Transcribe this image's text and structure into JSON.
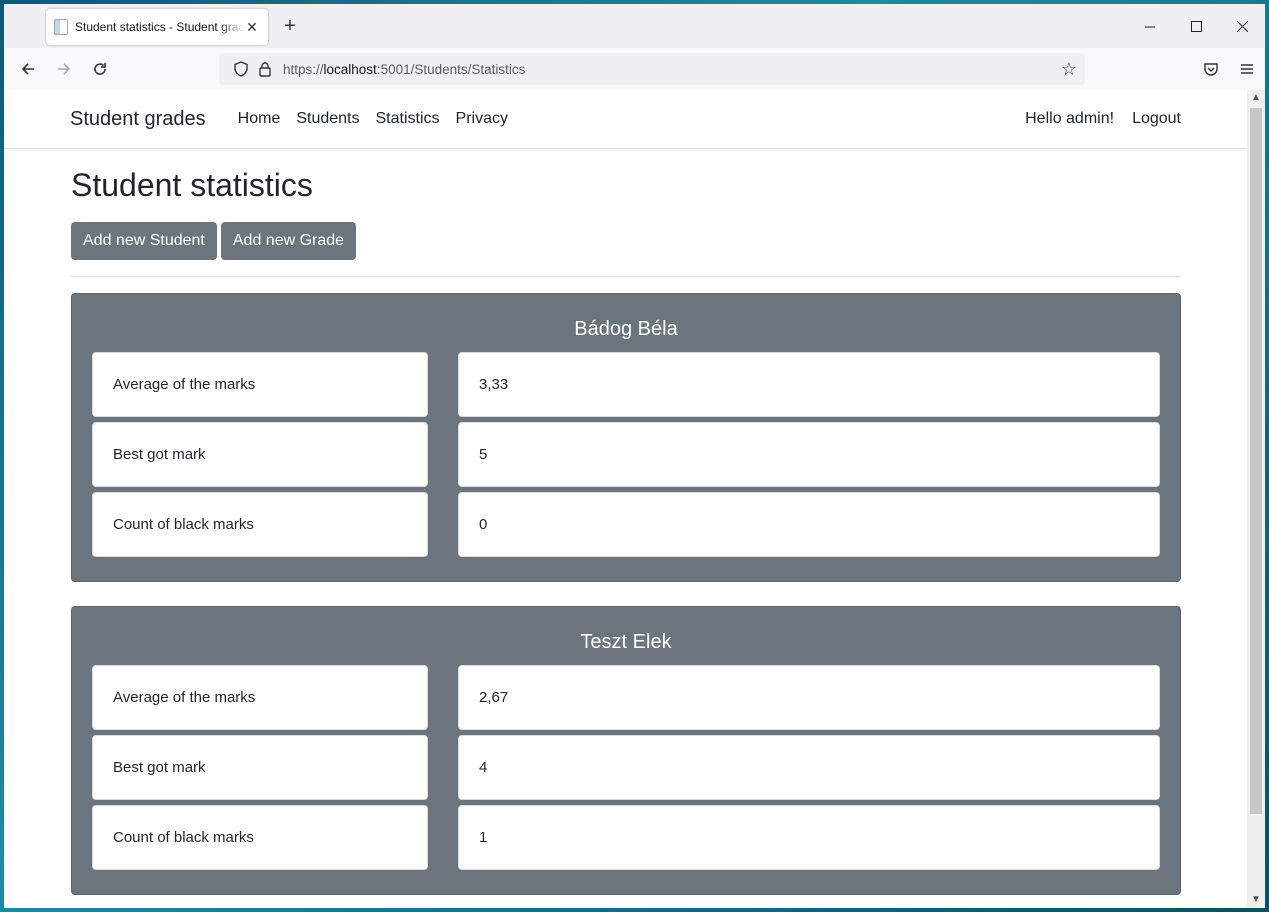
{
  "browser": {
    "tab_title": "Student statistics - Student grades",
    "url_prefix": "https://",
    "url_host": "localhost",
    "url_rest": ":5001/Students/Statistics"
  },
  "site": {
    "brand": "Student grades",
    "nav": [
      "Home",
      "Students",
      "Statistics",
      "Privacy"
    ],
    "greeting": "Hello admin!",
    "logout": "Logout"
  },
  "page": {
    "title": "Student statistics",
    "add_student": "Add new Student",
    "add_grade": "Add new Grade"
  },
  "students": [
    {
      "name": "Bádog Béla",
      "stats": [
        {
          "label": "Average of the marks",
          "value": "3,33"
        },
        {
          "label": "Best got mark",
          "value": "5"
        },
        {
          "label": "Count of black marks",
          "value": "0"
        }
      ]
    },
    {
      "name": "Teszt Elek",
      "stats": [
        {
          "label": "Average of the marks",
          "value": "2,67"
        },
        {
          "label": "Best got mark",
          "value": "4"
        },
        {
          "label": "Count of black marks",
          "value": "1"
        }
      ]
    }
  ]
}
